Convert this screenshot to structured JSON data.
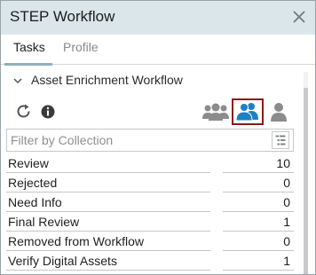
{
  "window": {
    "title": "STEP Workflow"
  },
  "tabs": [
    {
      "label": "Tasks",
      "active": true
    },
    {
      "label": "Profile",
      "active": false
    }
  ],
  "section": {
    "title": "Asset Enrichment Workflow",
    "expanded": true
  },
  "toolbar": {
    "icons": [
      "refresh-icon",
      "info-icon",
      "group-users-icon",
      "my-tasks-icon",
      "single-user-icon"
    ],
    "selected": "my-tasks-icon",
    "selected_border_color": "#8b1a1a",
    "user_icon_active_color": "#1e7fc2",
    "user_icon_inactive_color": "#8c8c8c"
  },
  "filter": {
    "placeholder": "Filter by Collection",
    "value": ""
  },
  "tasks": [
    {
      "name": "Review",
      "count": "10"
    },
    {
      "name": "Rejected",
      "count": "0"
    },
    {
      "name": "Need Info",
      "count": "0"
    },
    {
      "name": "Final Review",
      "count": "1"
    },
    {
      "name": "Removed from Workflow",
      "count": "0"
    },
    {
      "name": "Verify Digital Assets",
      "count": "1"
    }
  ]
}
